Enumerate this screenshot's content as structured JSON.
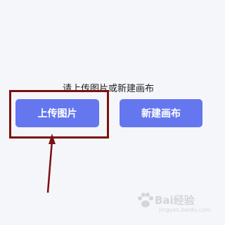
{
  "prompt": {
    "text": "请上传图片或新建画布"
  },
  "buttons": {
    "upload_label": "上传图片",
    "new_canvas_label": "新建画布"
  },
  "annotation": {
    "highlight_color": "#7a1111",
    "arrow_color": "#7a1111"
  },
  "watermark": {
    "text": "Bai经验",
    "subtext": "jingyan.baidu.com"
  },
  "colors": {
    "background": "#f5f6fa",
    "button": "#6477ee",
    "button_text": "#ffffff"
  }
}
